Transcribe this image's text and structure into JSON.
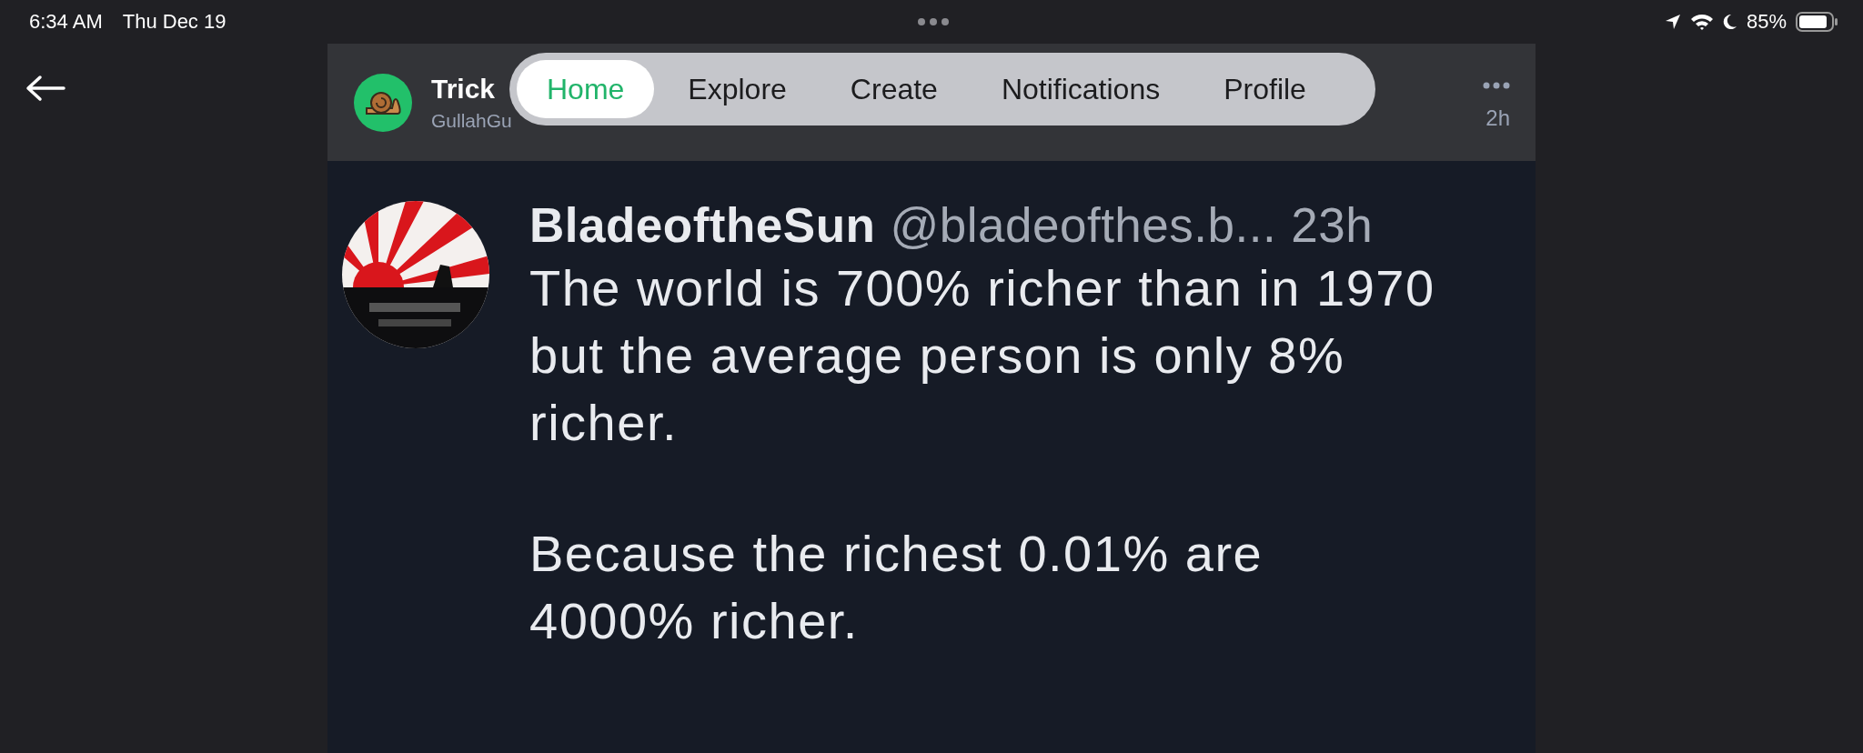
{
  "status_bar": {
    "time": "6:34 AM",
    "date": "Thu Dec 19",
    "battery": "85%"
  },
  "post_header": {
    "name": "Trick",
    "handle": "GullahGu",
    "age": "2h"
  },
  "nav_tabs": [
    {
      "label": "Home",
      "selected": true
    },
    {
      "label": "Explore",
      "selected": false
    },
    {
      "label": "Create",
      "selected": false
    },
    {
      "label": "Notifications",
      "selected": false
    },
    {
      "label": "Profile",
      "selected": false
    }
  ],
  "embedded_post": {
    "name": "BladeoftheSun",
    "handle": "@bladeofthes.b...",
    "age": "23h",
    "paragraphs": [
      {
        "lines": [
          "The world is 700% richer than in 1970",
          "but the average person is only 8%",
          "richer."
        ]
      },
      {
        "lines": [
          "Because the richest 0.01% are",
          "4000% richer."
        ]
      }
    ]
  }
}
